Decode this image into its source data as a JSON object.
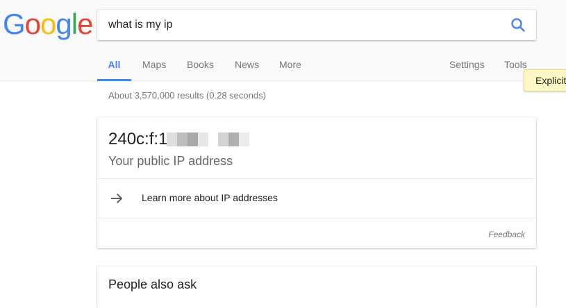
{
  "logo": {
    "letters": [
      {
        "char": "G",
        "color": "#4285F4"
      },
      {
        "char": "o",
        "color": "#EA4335"
      },
      {
        "char": "o",
        "color": "#FBBC05"
      },
      {
        "char": "g",
        "color": "#4285F4"
      },
      {
        "char": "l",
        "color": "#34A853"
      },
      {
        "char": "e",
        "color": "#EA4335"
      }
    ]
  },
  "search": {
    "value": "what is my ip",
    "button_icon": "search-icon",
    "accent_color": "#4285F4"
  },
  "tabs": {
    "all": "All",
    "maps": "Maps",
    "books": "Books",
    "news": "News",
    "more": "More",
    "settings": "Settings",
    "tools": "Tools"
  },
  "tooltip": {
    "label": "Explicit"
  },
  "results": {
    "stats": "About 3,570,000 results (0.28 seconds)"
  },
  "ip_card": {
    "ip_visible": "240c:f:1",
    "caption": "Your public IP address",
    "learn_more": "Learn more about IP addresses",
    "learn_icon": "arrow-right-icon",
    "feedback": "Feedback"
  },
  "people_also_ask": {
    "title": "People also ask"
  }
}
